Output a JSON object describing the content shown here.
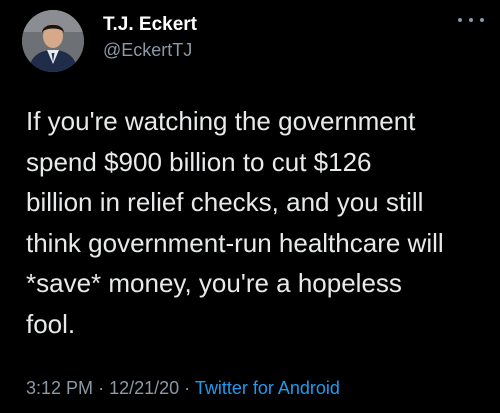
{
  "author": {
    "display_name": "T.J. Eckert",
    "handle": "@EckertTJ"
  },
  "tweet": {
    "text": "If you're watching the government\nspend $900 billion to cut $126\nbillion in relief checks, and you still\nthink government-run healthcare will\n*save* money, you're a hopeless\nfool."
  },
  "meta": {
    "time": "3:12 PM",
    "separator_1": "·",
    "date": "12/21/20",
    "separator_2": "·",
    "source": "Twitter for Android"
  },
  "icons": {
    "more": "more-horizontal-icon",
    "avatar": "profile-photo"
  },
  "colors": {
    "background": "#000000",
    "text": "#e7e9ea",
    "secondary": "#8b98a5",
    "link": "#1d9bf0"
  }
}
